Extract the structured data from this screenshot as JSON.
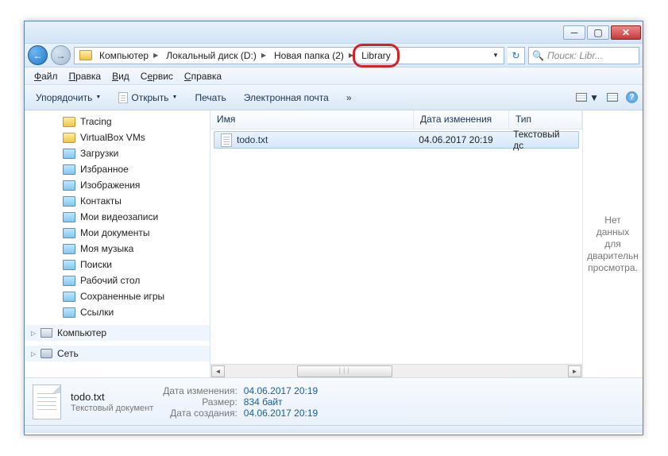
{
  "breadcrumb": {
    "root": "Компьютер",
    "drive": "Локальный диск (D:)",
    "folder": "Новая папка (2)",
    "current": "Library"
  },
  "search": {
    "placeholder": "Поиск: Libr..."
  },
  "menu": {
    "file": "Файл",
    "edit": "Правка",
    "view": "Вид",
    "tools": "Сервис",
    "help": "Справка"
  },
  "toolbar": {
    "organize": "Упорядочить",
    "open": "Открыть",
    "print": "Печать",
    "email": "Электронная почта",
    "more": "»"
  },
  "tree": {
    "items": [
      "Tracing",
      "VirtualBox VMs",
      "Загрузки",
      "Избранное",
      "Изображения",
      "Контакты",
      "Мои видеозаписи",
      "Мои документы",
      "Моя музыка",
      "Поиски",
      "Рабочий стол",
      "Сохраненные игры",
      "Ссылки"
    ],
    "computer": "Компьютер",
    "network": "Сеть"
  },
  "columns": {
    "name": "Имя",
    "date": "Дата изменения",
    "type": "Тип"
  },
  "files": [
    {
      "name": "todo.txt",
      "date": "04.06.2017 20:19",
      "type": "Текстовый дс"
    }
  ],
  "preview": {
    "empty": "Нет данных для дварительн просмотра."
  },
  "details": {
    "name": "todo.txt",
    "type_label": "Текстовый документ",
    "mod_label": "Дата изменения:",
    "mod_value": "04.06.2017 20:19",
    "size_label": "Размер:",
    "size_value": "834 байт",
    "created_label": "Дата создания:",
    "created_value": "04.06.2017 20:19"
  }
}
